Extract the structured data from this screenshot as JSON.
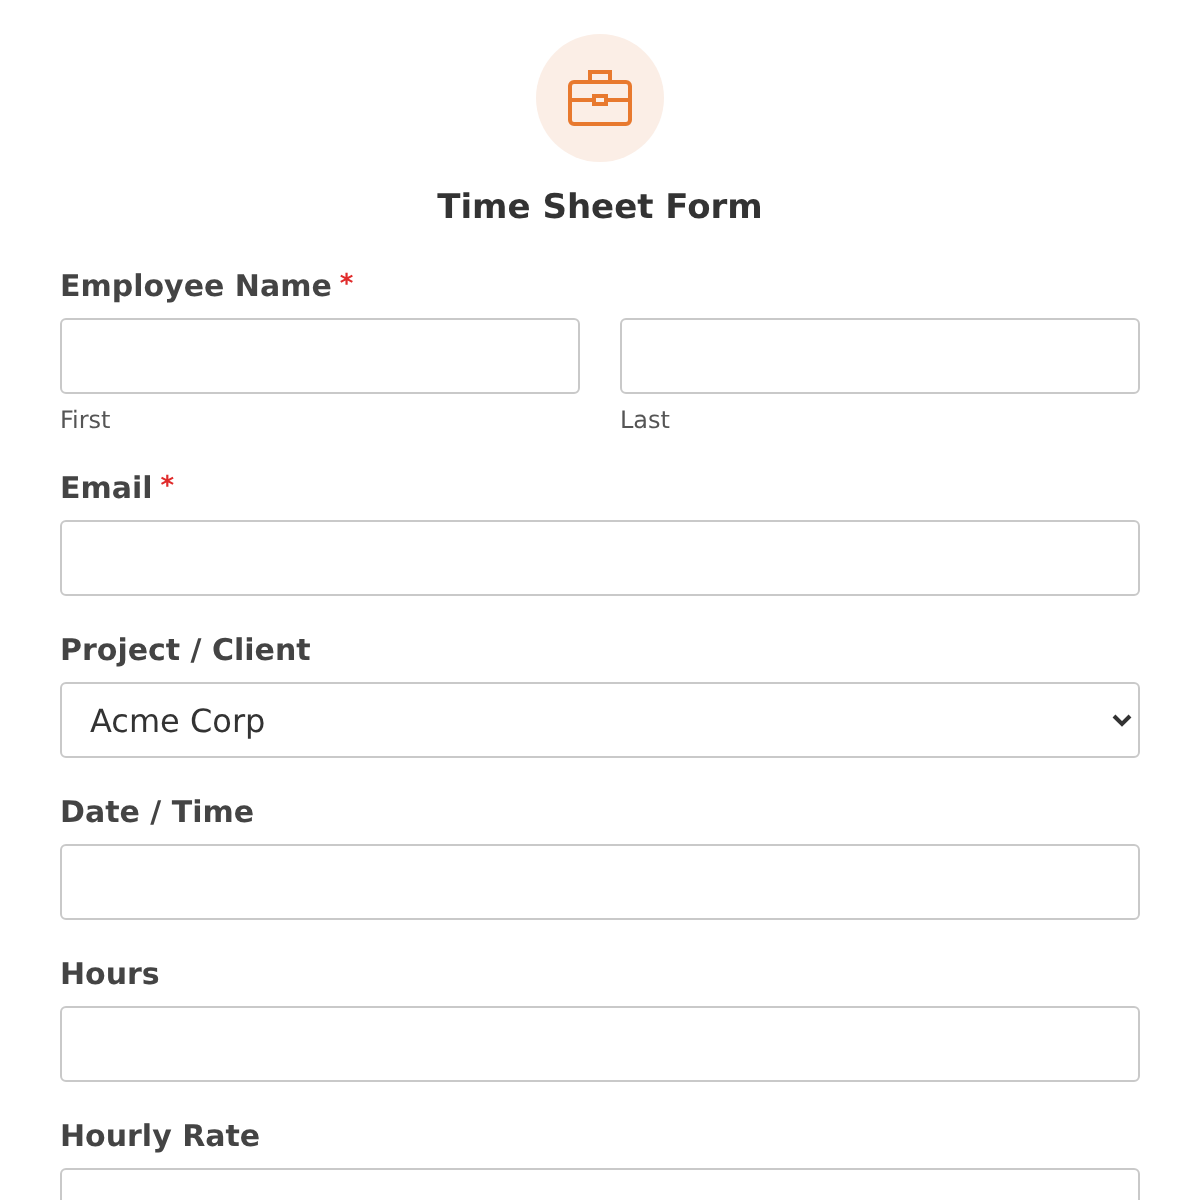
{
  "form": {
    "title": "Time Sheet Form"
  },
  "fields": [
    {
      "kind": "name",
      "label": "Employee Name",
      "required_mark": "*",
      "parts": [
        {
          "sublabel": "First"
        },
        {
          "sublabel": "Last"
        }
      ]
    },
    {
      "kind": "text",
      "label": "Email",
      "required_mark": "*"
    },
    {
      "kind": "select",
      "label": "Project / Client",
      "value": "Acme Corp"
    },
    {
      "kind": "text",
      "label": "Date / Time"
    },
    {
      "kind": "text",
      "label": "Hours"
    },
    {
      "kind": "text",
      "label": "Hourly Rate"
    }
  ]
}
